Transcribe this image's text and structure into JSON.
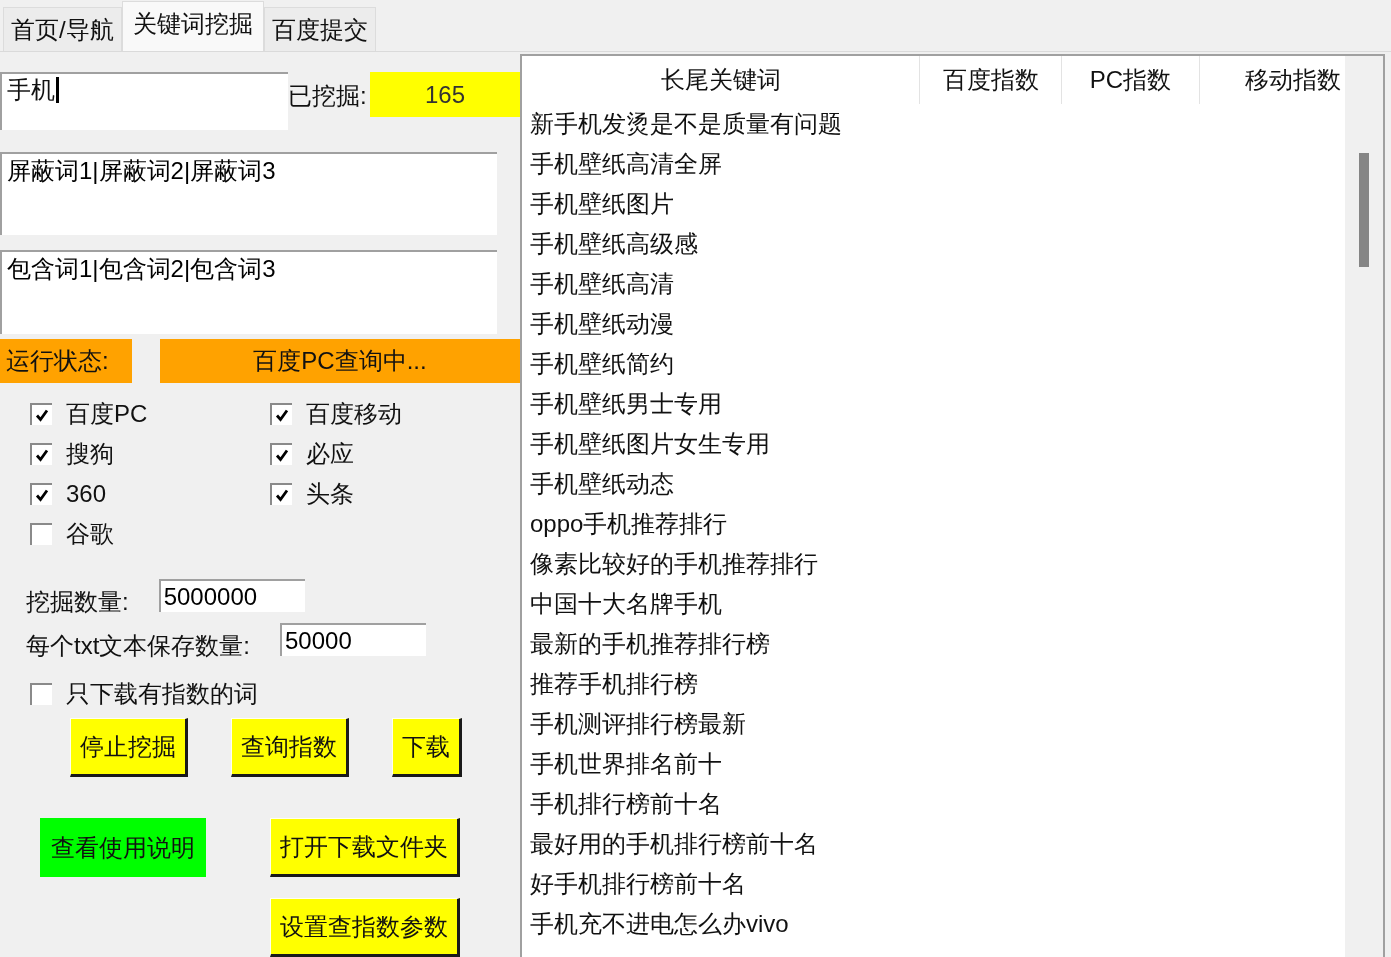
{
  "tabs": [
    {
      "label": "首页/导航",
      "selected": false
    },
    {
      "label": "关键词挖掘",
      "selected": true
    },
    {
      "label": "百度提交",
      "selected": false
    }
  ],
  "keyword_input": {
    "value": "手机",
    "focused": true
  },
  "mined": {
    "label": "已挖掘:",
    "value": "165"
  },
  "exclude_words": {
    "value": "屏蔽词1|屏蔽词2|屏蔽词3"
  },
  "include_words": {
    "value": "包含词1|包含词2|包含词3"
  },
  "status": {
    "label": "运行状态:",
    "value": "百度PC查询中..."
  },
  "engines": [
    {
      "label": "百度PC",
      "checked": true
    },
    {
      "label": "百度移动",
      "checked": true
    },
    {
      "label": "搜狗",
      "checked": true
    },
    {
      "label": "必应",
      "checked": true
    },
    {
      "label": "360",
      "checked": true
    },
    {
      "label": "头条",
      "checked": true
    },
    {
      "label": "谷歌",
      "checked": false
    }
  ],
  "settings": [
    {
      "label": "挖掘数量:",
      "value": "5000000"
    },
    {
      "label": "每个txt文本保存数量:",
      "value": "50000"
    }
  ],
  "only_indexed": {
    "label": "只下载有指数的词",
    "checked": false
  },
  "buttons": [
    {
      "label": "停止挖掘",
      "color": "#ffff00",
      "kind": "raised"
    },
    {
      "label": "查询指数",
      "color": "#ffff00",
      "kind": "raised"
    },
    {
      "label": "下载",
      "color": "#ffff00",
      "kind": "raised"
    },
    {
      "label": "查看使用说明",
      "color": "#00ff00",
      "kind": "flat"
    },
    {
      "label": "打开下载文件夹",
      "color": "#ffff00",
      "kind": "raised"
    },
    {
      "label": "设置查指数参数",
      "color": "#ffff00",
      "kind": "raised"
    }
  ],
  "table": {
    "columns": [
      "长尾关键词",
      "百度指数",
      "PC指数",
      "移动指数"
    ],
    "rows": [
      "新手机发烫是不是质量有问题",
      "手机壁纸高清全屏",
      "手机壁纸图片",
      "手机壁纸高级感",
      "手机壁纸高清",
      "手机壁纸动漫",
      "手机壁纸简约",
      "手机壁纸男士专用",
      "手机壁纸图片女生专用",
      "手机壁纸动态",
      "oppo手机推荐排行",
      "像素比较好的手机推荐排行",
      "中国十大名牌手机",
      "最新的手机推荐排行榜",
      "推荐手机排行榜",
      "手机测评排行榜最新",
      "手机世界排名前十",
      "手机排行榜前十名",
      "最好用的手机排行榜前十名",
      "好手机排行榜前十名",
      "手机充不进电怎么办vivo"
    ]
  }
}
